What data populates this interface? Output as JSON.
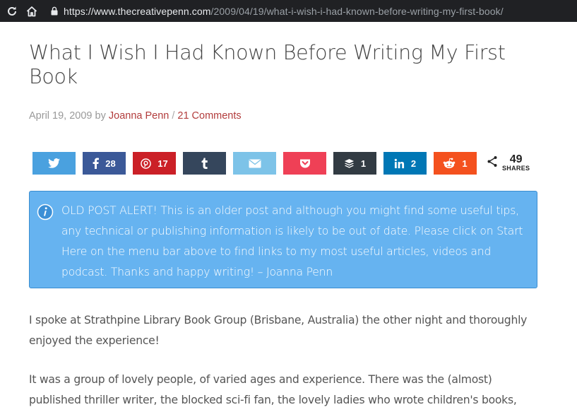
{
  "browser": {
    "url_host": "https://www.thecreativepenn.com",
    "url_path": "/2009/04/19/what-i-wish-i-had-known-before-writing-my-first-book/",
    "icons": [
      "reload-icon",
      "home-icon",
      "lock-icon"
    ]
  },
  "article": {
    "title": "What I Wish I Had Known Before Writing My First Book",
    "date": "April 19, 2009",
    "by": "by",
    "author": "Joanna Penn",
    "separator": "/",
    "comments": "21 Comments"
  },
  "share": {
    "buttons": [
      {
        "network": "twitter",
        "icon": "twitter-icon",
        "color": "#4aa1df",
        "count": ""
      },
      {
        "network": "facebook",
        "icon": "facebook-icon",
        "color": "#3b5998",
        "count": "28"
      },
      {
        "network": "pinterest",
        "icon": "pinterest-icon",
        "color": "#cb2027",
        "count": "17"
      },
      {
        "network": "tumblr",
        "icon": "tumblr-icon",
        "color": "#35465c",
        "count": ""
      },
      {
        "network": "email",
        "icon": "mail-icon",
        "color": "#7dc3e8",
        "count": ""
      },
      {
        "network": "pocket",
        "icon": "pocket-icon",
        "color": "#ef4056",
        "count": ""
      },
      {
        "network": "buffer",
        "icon": "buffer-icon",
        "color": "#323b43",
        "count": "1"
      },
      {
        "network": "linkedin",
        "icon": "linkedin-icon",
        "color": "#0077b5",
        "count": "2"
      },
      {
        "network": "reddit",
        "icon": "reddit-icon",
        "color": "#f4511e",
        "count": "1"
      }
    ],
    "total": "49",
    "total_label": "SHARES"
  },
  "alert": {
    "icon": "info-icon",
    "text": "OLD POST ALERT! This is an older post and although you might find some useful tips, any technical or publishing information is likely to be out of date. Please click on Start Here on the menu bar above to find links to my most useful articles, videos and podcast. Thanks and happy writing! – Joanna Penn"
  },
  "body": {
    "p1": "I spoke at Strathpine Library Book Group (Brisbane, Australia) the other night and thoroughly enjoyed the experience!",
    "p2": "It was a group of lovely people, of varied ages and experience.  There was the (almost) published thriller writer, the blocked sci-fi fan, the lovely ladies who wrote children's books,"
  }
}
